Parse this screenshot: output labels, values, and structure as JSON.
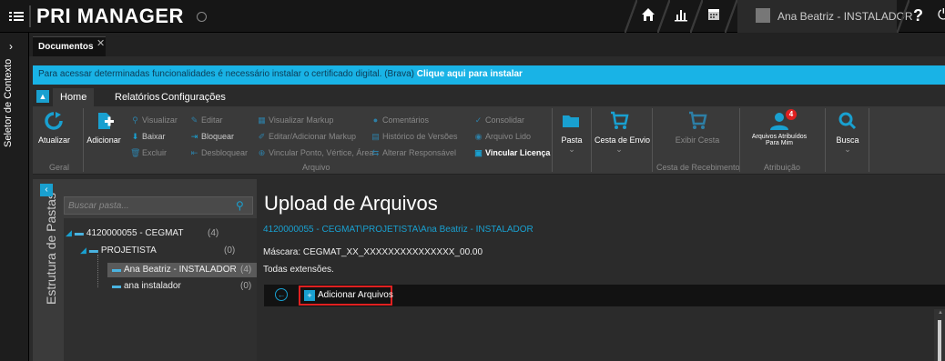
{
  "app": {
    "logo": "PRI MANAGER",
    "user_name": "Ana Beatriz - INSTALADOR",
    "help": "?"
  },
  "context_strip": {
    "label": "Seletor de Contexto"
  },
  "doc_tabs": [
    {
      "label": "Documentos"
    }
  ],
  "infobar": {
    "text": "Para acessar determinadas funcionalidades é necessário instalar o certificado digital. (Brava)",
    "link": "Clique aqui para instalar"
  },
  "ribbon_tabs": [
    {
      "label": "Home"
    },
    {
      "label": "Relatórios"
    },
    {
      "label": "Configurações"
    }
  ],
  "ribbon": {
    "geral": {
      "group_label": "Geral",
      "atualizar": "Atualizar"
    },
    "arquivo": {
      "group_label": "Arquivo",
      "adicionar": "Adicionar",
      "visualizar": "Visualizar",
      "editar": "Editar",
      "baixar": "Baixar",
      "bloquear": "Bloquear",
      "excluir": "Excluir",
      "desbloquear": "Desbloquear",
      "visualizar_markup": "Visualizar Markup",
      "editar_markup": "Editar/Adicionar Markup",
      "vincular_ponto": "Vincular Ponto, Vértice, Área",
      "comentarios": "Comentários",
      "historico": "Histórico de Versões",
      "alterar_responsavel": "Alterar Responsável",
      "consolidar": "Consolidar",
      "arquivo_lido": "Arquivo Lido",
      "vincular_licenca": "Vincular Licença",
      "pasta": "Pasta",
      "cesta_envio": "Cesta de Envio"
    },
    "recebimento": {
      "group_label": "Cesta de Recebimento",
      "exibir_cesta": "Exibir Cesta"
    },
    "atribuicao": {
      "group_label": "Atribuição",
      "arquivos_atribuidos_1": "Arquivos Atribuídos",
      "arquivos_atribuidos_2": "Para Mim",
      "badge": "4",
      "busca": "Busca"
    }
  },
  "folder_panel": {
    "vertical_label": "Estrutura de Pastas",
    "search_placeholder": "Buscar pasta...",
    "tree": [
      {
        "label": "4120000055 - CEGMAT",
        "count": "(4)"
      },
      {
        "label": "PROJETISTA",
        "count": "(0)"
      },
      {
        "label": "Ana Beatriz - INSTALADOR",
        "count": "(4)",
        "selected": true
      },
      {
        "label": "ana instalador",
        "count": "(0)"
      }
    ]
  },
  "upload": {
    "title": "Upload de Arquivos",
    "path": "4120000055 - CEGMAT\\PROJETISTA\\Ana Beatriz - INSTALADOR",
    "mask": "Máscara: CEGMAT_XX_XXXXXXXXXXXXXXX_00.00",
    "extensions": "Todas extensões.",
    "add_files": "Adicionar Arquivos"
  },
  "colors": {
    "accent": "#19a0d0",
    "infobar": "#19b3e6",
    "highlight_border": "#e02020",
    "badge": "#e02020"
  }
}
